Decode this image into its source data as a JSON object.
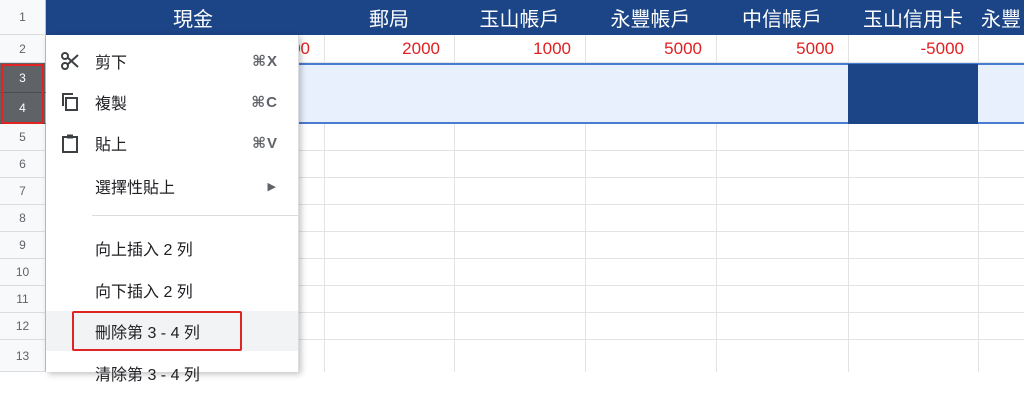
{
  "row_headers": [
    "1",
    "2",
    "3",
    "4",
    "5",
    "6",
    "7",
    "8",
    "9",
    "10",
    "11",
    "12",
    "13"
  ],
  "columns": [
    {
      "title": "現金",
      "value": "00"
    },
    {
      "title": "郵局",
      "value": "2000"
    },
    {
      "title": "玉山帳戶",
      "value": "1000"
    },
    {
      "title": "永豐帳戶",
      "value": "5000"
    },
    {
      "title": "中信帳戶",
      "value": "5000"
    },
    {
      "title": "玉山信用卡",
      "value": "-5000"
    },
    {
      "title": "永豐",
      "value": ""
    }
  ],
  "context_menu": {
    "cut": {
      "label": "剪下",
      "shortcut": "⌘X",
      "icon": "scissors-icon"
    },
    "copy": {
      "label": "複製",
      "shortcut": "⌘C",
      "icon": "copy-icon"
    },
    "paste": {
      "label": "貼上",
      "shortcut": "⌘V",
      "icon": "clipboard-icon"
    },
    "paste_special": {
      "label": "選擇性貼上",
      "icon": "chevron-right-icon"
    },
    "insert_above": {
      "label": "向上插入 2 列"
    },
    "insert_below": {
      "label": "向下插入 2 列"
    },
    "delete_rows": {
      "label": "刪除第 3 - 4 列"
    },
    "clear_rows": {
      "label": "清除第 3 - 4 列"
    }
  },
  "colors": {
    "header_bg": "#1c4587",
    "highlight": "#e02424",
    "value_text": "#e02020",
    "selection_bg": "#e8f0fe"
  }
}
